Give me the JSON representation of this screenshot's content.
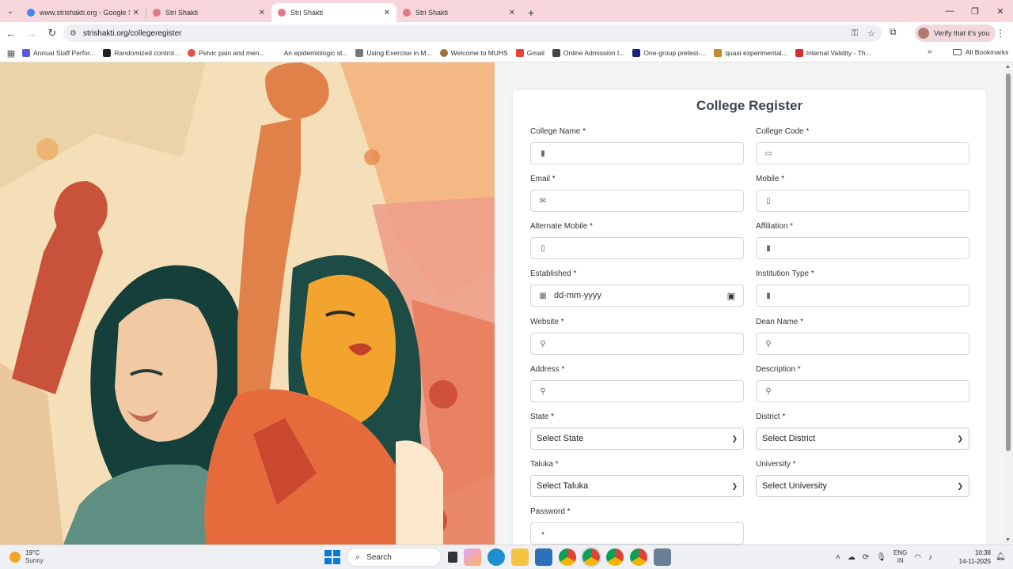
{
  "browser": {
    "tabs": [
      {
        "title": "www.strishakti.org - Google Se",
        "favicon_color": "#4285f4",
        "active": false
      },
      {
        "title": "Stri Shakti",
        "favicon_color": "#e07a8a",
        "active": false
      },
      {
        "title": "Stri Shakti",
        "favicon_color": "#e07a8a",
        "active": true
      },
      {
        "title": "Stri Shakti",
        "favicon_color": "#e07a8a",
        "active": false
      }
    ],
    "new_tab": "+",
    "url": "strishakti.org/collegeregister",
    "profile_label": "Verify that it's you",
    "bookmarks": [
      {
        "label": "Annual Staff Perfor...",
        "color": "#5b5bd6"
      },
      {
        "label": "Randomized control...",
        "color": "#222222"
      },
      {
        "label": "Pelvic pain and men...",
        "color": "#d9534f"
      },
      {
        "label": "An epidemiologic st...",
        "color": "#ffffff"
      },
      {
        "label": "Using Exercise in M...",
        "color": "#777777"
      },
      {
        "label": "Welcome to MUHS",
        "color": "#a07040"
      },
      {
        "label": "Gmail",
        "color": "#ea4335"
      },
      {
        "label": "Online Admission t...",
        "color": "#444444"
      },
      {
        "label": "One-group pretest-...",
        "color": "#1a237e"
      },
      {
        "label": "quasi experimental...",
        "color": "#c68a2e"
      },
      {
        "label": "Internal Validity - Th...",
        "color": "#d32f2f"
      }
    ],
    "all_bookmarks": "All Bookmarks"
  },
  "form": {
    "title": "College Register",
    "fields": {
      "college_name": {
        "label": "College Name *",
        "icon": "building-icon"
      },
      "college_code": {
        "label": "College Code *",
        "icon": "id-card-icon"
      },
      "email": {
        "label": "Email *",
        "icon": "envelope-icon"
      },
      "mobile": {
        "label": "Mobile *",
        "icon": "mobile-icon"
      },
      "alternate_mobile": {
        "label": "Alternate Mobile *",
        "icon": "mobile-icon"
      },
      "affiliation": {
        "label": "Affiliation *",
        "icon": "building-icon"
      },
      "established": {
        "label": "Established *",
        "icon": "calendar-icon",
        "value": "dd-mm-yyyy"
      },
      "institution_type": {
        "label": "Institution Type *",
        "icon": "building-icon"
      },
      "website": {
        "label": "Website *",
        "icon": "map-pin-icon"
      },
      "dean_name": {
        "label": "Dean Name *",
        "icon": "map-pin-icon"
      },
      "address": {
        "label": "Address *",
        "icon": "map-pin-icon"
      },
      "description": {
        "label": "Description *",
        "icon": "map-pin-icon"
      },
      "state": {
        "label": "State *",
        "selected": "Select State"
      },
      "district": {
        "label": "District *",
        "selected": "Select District"
      },
      "taluka": {
        "label": "Taluka *",
        "selected": "Select Taluka"
      },
      "university": {
        "label": "University *",
        "selected": "Select University"
      },
      "password": {
        "label": "Password *",
        "icon": "lock-icon"
      }
    }
  },
  "taskbar": {
    "weather_temp": "19°C",
    "weather_desc": "Sunny",
    "search_label": "Search",
    "lang_top": "ENG",
    "lang_bottom": "IN",
    "time": "10:38",
    "date": "14-11-2025"
  }
}
